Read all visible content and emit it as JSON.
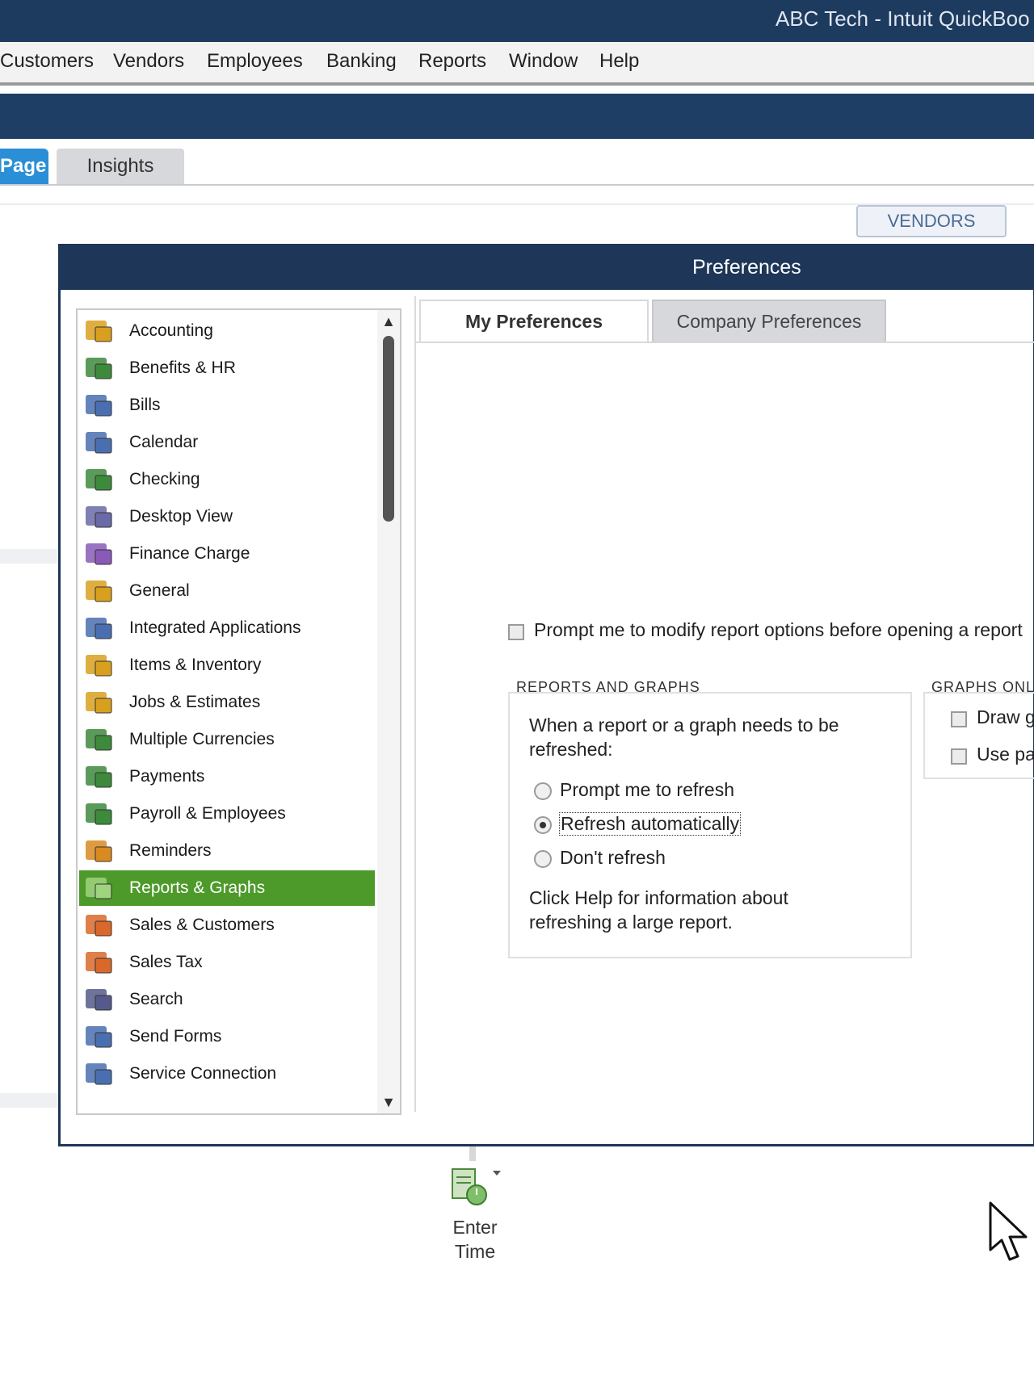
{
  "window": {
    "title": "ABC Tech  - Intuit QuickBoo"
  },
  "menu": {
    "items": [
      "Customers",
      "Vendors",
      "Employees",
      "Banking",
      "Reports",
      "Window",
      "Help"
    ]
  },
  "tabs": {
    "home": "Page",
    "insights": "Insights"
  },
  "vendors_button": "VENDORS",
  "dialog": {
    "title": "Preferences",
    "categories": [
      {
        "label": "Accounting",
        "icon": "accounting-icon"
      },
      {
        "label": "Benefits & HR",
        "icon": "benefits-icon"
      },
      {
        "label": "Bills",
        "icon": "bills-icon"
      },
      {
        "label": "Calendar",
        "icon": "calendar-icon"
      },
      {
        "label": "Checking",
        "icon": "checking-icon"
      },
      {
        "label": "Desktop View",
        "icon": "desktop-view-icon"
      },
      {
        "label": "Finance Charge",
        "icon": "finance-charge-icon"
      },
      {
        "label": "General",
        "icon": "general-icon"
      },
      {
        "label": "Integrated Applications",
        "icon": "integrated-apps-icon"
      },
      {
        "label": "Items & Inventory",
        "icon": "items-inventory-icon"
      },
      {
        "label": "Jobs & Estimates",
        "icon": "jobs-estimates-icon"
      },
      {
        "label": "Multiple Currencies",
        "icon": "currencies-icon"
      },
      {
        "label": "Payments",
        "icon": "payments-icon"
      },
      {
        "label": "Payroll & Employees",
        "icon": "payroll-icon"
      },
      {
        "label": "Reminders",
        "icon": "reminders-icon"
      },
      {
        "label": "Reports & Graphs",
        "icon": "reports-graphs-icon",
        "selected": true
      },
      {
        "label": "Sales & Customers",
        "icon": "sales-customers-icon"
      },
      {
        "label": "Sales Tax",
        "icon": "sales-tax-icon"
      },
      {
        "label": "Search",
        "icon": "search-icon"
      },
      {
        "label": "Send Forms",
        "icon": "send-forms-icon"
      },
      {
        "label": "Service Connection",
        "icon": "service-connection-icon"
      }
    ],
    "tab_my": "My Preferences",
    "tab_company": "Company Preferences",
    "prompt_modify": "Prompt me to modify report options before opening a report",
    "reports_group": {
      "label": "REPORTS AND GRAPHS",
      "question": "When a report or a graph needs to be refreshed:",
      "options": [
        "Prompt me to refresh",
        "Refresh automatically",
        "Don't refresh"
      ],
      "selected": "Refresh automatically",
      "help_text": "Click Help for information about refreshing a large report."
    },
    "graphs_group": {
      "label": "GRAPHS ONLY",
      "draw_graphs": "Draw graphs",
      "use_patterns": "Use patterns"
    }
  },
  "enter_time": {
    "label_line1": "Enter",
    "label_line2": "Time"
  },
  "colors": {
    "title_bar": "#1d3a5f",
    "selected_item": "#4d9a2a",
    "home_tab": "#2a8fd6"
  }
}
